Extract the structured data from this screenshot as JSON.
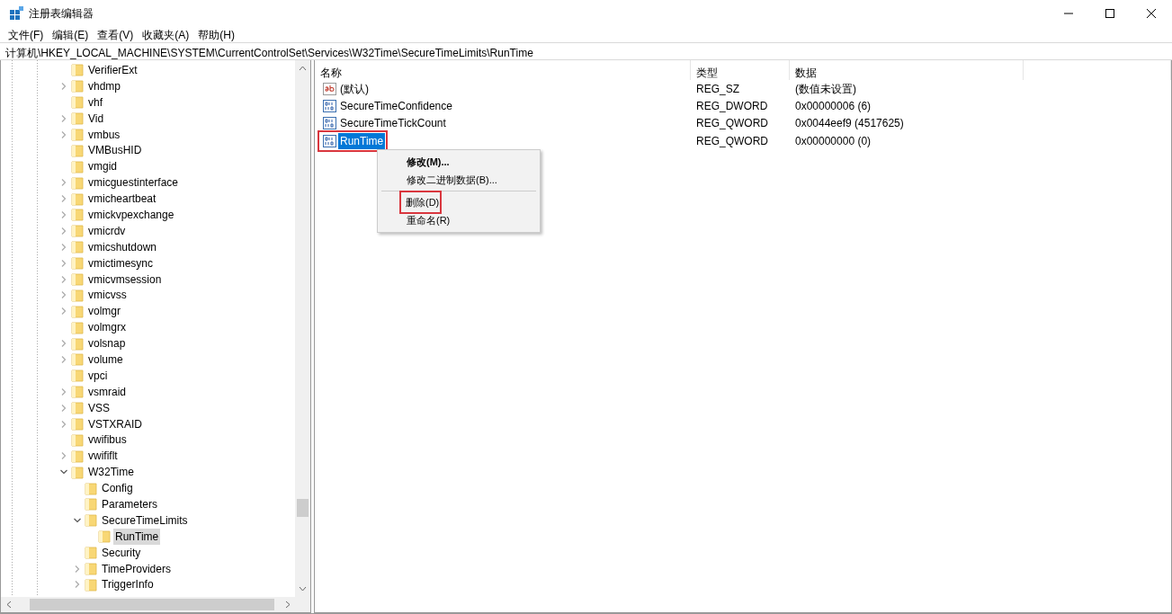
{
  "window": {
    "title": "注册表编辑器"
  },
  "menu": [
    "文件(F)",
    "编辑(E)",
    "查看(V)",
    "收藏夹(A)",
    "帮助(H)"
  ],
  "address": "计算机\\HKEY_LOCAL_MACHINE\\SYSTEM\\CurrentControlSet\\Services\\W32Time\\SecureTimeLimits\\RunTime",
  "tree": [
    {
      "label": "VerifierExt",
      "kind": "leaf",
      "selected": false
    },
    {
      "label": "vhdmp",
      "kind": "node",
      "expanded": false,
      "selected": false
    },
    {
      "label": "vhf",
      "kind": "leaf",
      "selected": false
    },
    {
      "label": "Vid",
      "kind": "node",
      "expanded": false,
      "selected": false
    },
    {
      "label": "vmbus",
      "kind": "node",
      "expanded": false,
      "selected": false
    },
    {
      "label": "VMBusHID",
      "kind": "leaf",
      "selected": false
    },
    {
      "label": "vmgid",
      "kind": "leaf",
      "selected": false
    },
    {
      "label": "vmicguestinterface",
      "kind": "node",
      "expanded": false,
      "selected": false
    },
    {
      "label": "vmicheartbeat",
      "kind": "node",
      "expanded": false,
      "selected": false
    },
    {
      "label": "vmickvpexchange",
      "kind": "node",
      "expanded": false,
      "selected": false
    },
    {
      "label": "vmicrdv",
      "kind": "node",
      "expanded": false,
      "selected": false
    },
    {
      "label": "vmicshutdown",
      "kind": "node",
      "expanded": false,
      "selected": false
    },
    {
      "label": "vmictimesync",
      "kind": "node",
      "expanded": false,
      "selected": false
    },
    {
      "label": "vmicvmsession",
      "kind": "node",
      "expanded": false,
      "selected": false
    },
    {
      "label": "vmicvss",
      "kind": "node",
      "expanded": false,
      "selected": false
    },
    {
      "label": "volmgr",
      "kind": "node",
      "expanded": false,
      "selected": false
    },
    {
      "label": "volmgrx",
      "kind": "leaf",
      "selected": false
    },
    {
      "label": "volsnap",
      "kind": "node",
      "expanded": false,
      "selected": false
    },
    {
      "label": "volume",
      "kind": "node",
      "expanded": false,
      "selected": false
    },
    {
      "label": "vpci",
      "kind": "leaf",
      "selected": false
    },
    {
      "label": "vsmraid",
      "kind": "node",
      "expanded": false,
      "selected": false
    },
    {
      "label": "VSS",
      "kind": "node",
      "expanded": false,
      "selected": false
    },
    {
      "label": "VSTXRAID",
      "kind": "node",
      "expanded": false,
      "selected": false
    },
    {
      "label": "vwifibus",
      "kind": "leaf",
      "selected": false
    },
    {
      "label": "vwififlt",
      "kind": "node",
      "expanded": false,
      "selected": false
    },
    {
      "label": "W32Time",
      "kind": "node",
      "expanded": true,
      "selected": false,
      "children": [
        {
          "label": "Config",
          "kind": "leaf",
          "selected": false
        },
        {
          "label": "Parameters",
          "kind": "leaf",
          "selected": false
        },
        {
          "label": "SecureTimeLimits",
          "kind": "node",
          "expanded": true,
          "selected": false,
          "children": [
            {
              "label": "RunTime",
              "kind": "leaf",
              "selected": true
            }
          ]
        },
        {
          "label": "Security",
          "kind": "leaf",
          "selected": false
        },
        {
          "label": "TimeProviders",
          "kind": "node",
          "expanded": false,
          "selected": false
        },
        {
          "label": "TriggerInfo",
          "kind": "node",
          "expanded": false,
          "selected": false
        }
      ]
    }
  ],
  "columns": [
    "名称",
    "类型",
    "数据"
  ],
  "values": [
    {
      "name": "(默认)",
      "kind": "string",
      "type": "REG_SZ",
      "data": "(数值未设置)",
      "selected": false,
      "highlighted": false
    },
    {
      "name": "SecureTimeConfidence",
      "kind": "binary",
      "type": "REG_DWORD",
      "data": "0x00000006 (6)",
      "selected": false,
      "highlighted": false
    },
    {
      "name": "SecureTimeTickCount",
      "kind": "binary",
      "type": "REG_QWORD",
      "data": "0x0044eef9 (4517625)",
      "selected": false,
      "highlighted": false
    },
    {
      "name": "RunTime",
      "kind": "binary",
      "type": "REG_QWORD",
      "data": "0x00000000 (0)",
      "selected": true,
      "highlighted": true
    }
  ],
  "context_menu": [
    {
      "kind": "item",
      "label": "修改(M)...",
      "default": true,
      "highlighted": false
    },
    {
      "kind": "item",
      "label": "修改二进制数据(B)...",
      "default": false,
      "highlighted": false
    },
    {
      "kind": "separator"
    },
    {
      "kind": "item",
      "label": "删除(D)",
      "default": false,
      "highlighted": true
    },
    {
      "kind": "item",
      "label": "重命名(R)",
      "default": false,
      "highlighted": false
    }
  ]
}
